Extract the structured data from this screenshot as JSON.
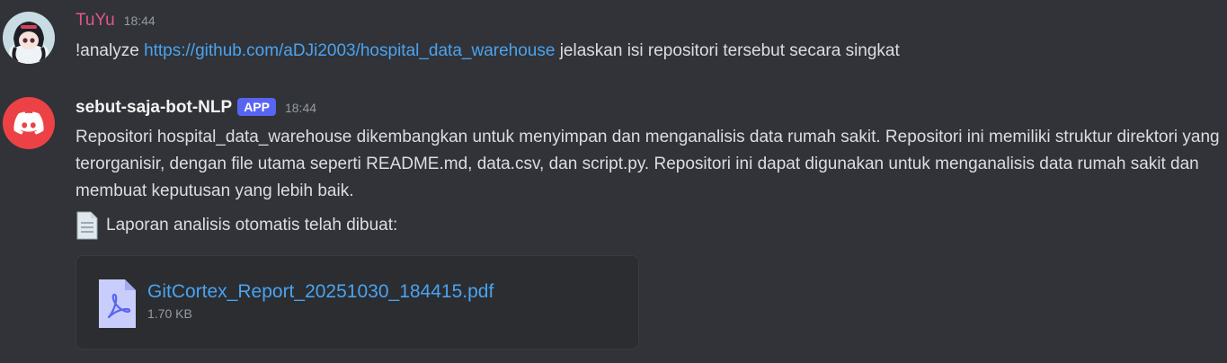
{
  "messages": [
    {
      "username": "TuYu",
      "username_color": "#e0578a",
      "timestamp": "18:44",
      "command": "!analyze",
      "link": "https://github.com/aDJi2003/hospital_data_warehouse",
      "text_after": "jelaskan isi repositori tersebut secara singkat"
    },
    {
      "username": "sebut-saja-bot-NLP",
      "username_color": "#f2f3f5",
      "badge": "APP",
      "timestamp": "18:44",
      "text": "Repositori hospital_data_warehouse dikembangkan untuk menyimpan dan menganalisis data rumah sakit. Repositori ini memiliki struktur direktori yang terorganisir, dengan file utama seperti README.md, data.csv, dan script.py. Repositori ini dapat digunakan untuk menganalisis data rumah sakit dan membuat keputusan yang lebih baik.",
      "report_line": "Laporan analisis otomatis telah dibuat:",
      "attachment": {
        "name": "GitCortex_Report_20251030_184415.pdf",
        "size": "1.70 KB",
        "icon": "pdf-file-icon"
      }
    }
  ],
  "colors": {
    "background": "#313338",
    "link": "#4aa3f0",
    "app_badge": "#5865f2",
    "discord_red": "#ed4245"
  }
}
